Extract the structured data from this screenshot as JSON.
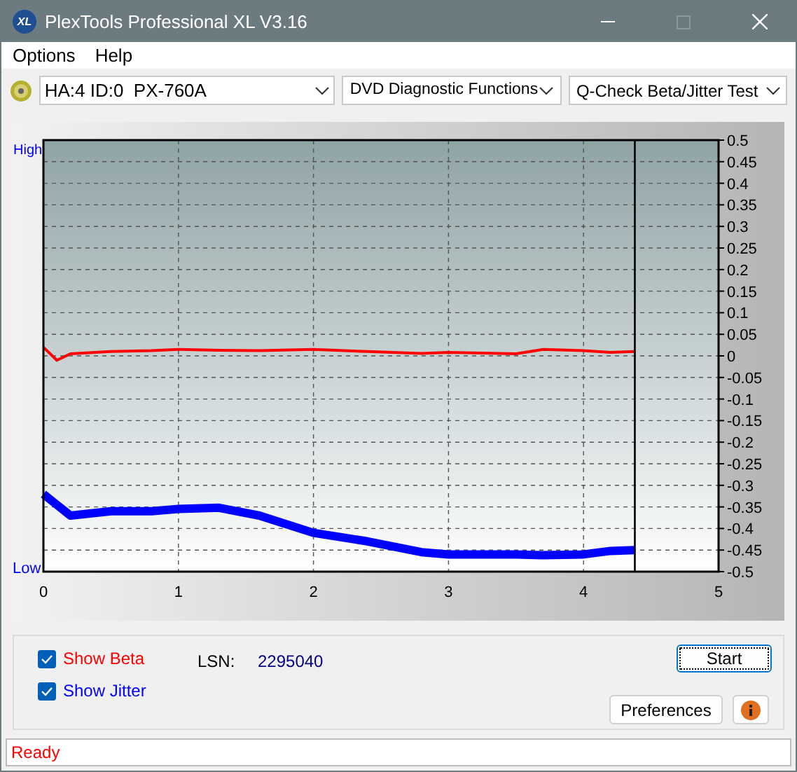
{
  "window": {
    "title": "PlexTools Professional XL V3.16",
    "logo_text": "XL"
  },
  "menu": [
    {
      "label": "Options"
    },
    {
      "label": "Help"
    }
  ],
  "toolbar": {
    "drive": "HA:4 ID:0  PX-760A",
    "function": "DVD Diagnostic Functions",
    "test": "Q-Check Beta/Jitter Test"
  },
  "chart": {
    "high_label": "High",
    "low_label": "Low",
    "chart_data": {
      "type": "line",
      "x": [
        0,
        0.1,
        0.2,
        0.5,
        0.8,
        1.0,
        1.3,
        1.6,
        2.0,
        2.4,
        2.8,
        3.0,
        3.5,
        3.7,
        4.0,
        4.2,
        4.38
      ],
      "series": [
        {
          "color": "#ff0000",
          "values": [
            0.02,
            -0.01,
            0.005,
            0.01,
            0.012,
            0.015,
            0.013,
            0.012,
            0.015,
            0.01,
            0.006,
            0.008,
            0.005,
            0.015,
            0.012,
            0.008,
            0.01
          ]
        },
        {
          "color": "#0000ff",
          "values": [
            -0.32,
            -0.345,
            -0.37,
            -0.36,
            -0.36,
            -0.355,
            -0.352,
            -0.37,
            -0.41,
            -0.43,
            -0.455,
            -0.46,
            -0.46,
            -0.462,
            -0.46,
            -0.452,
            -0.45
          ]
        }
      ],
      "xlim": [
        0,
        5
      ],
      "ylim": [
        -0.5,
        0.5
      ],
      "xticks": [
        0,
        1,
        2,
        3,
        4,
        5
      ],
      "yticks": [
        0.5,
        0.45,
        0.4,
        0.35,
        0.3,
        0.25,
        0.2,
        0.15,
        0.1,
        0.05,
        0,
        -0.05,
        -0.1,
        -0.15,
        -0.2,
        -0.25,
        -0.3,
        -0.35,
        -0.4,
        -0.45,
        -0.5
      ],
      "grid": true,
      "ref_lines": [
        {
          "axis": "x",
          "value": 4.38
        }
      ]
    }
  },
  "controls": {
    "checks": [
      {
        "label": "Show Beta",
        "checked": true,
        "color": "#ff0000"
      },
      {
        "label": "Show Jitter",
        "checked": true,
        "color": "#0000ff"
      }
    ],
    "lsn_label": "LSN:",
    "lsn_value": "2295040",
    "start": "Start",
    "preferences": "Preferences"
  },
  "status_bar": "Ready"
}
